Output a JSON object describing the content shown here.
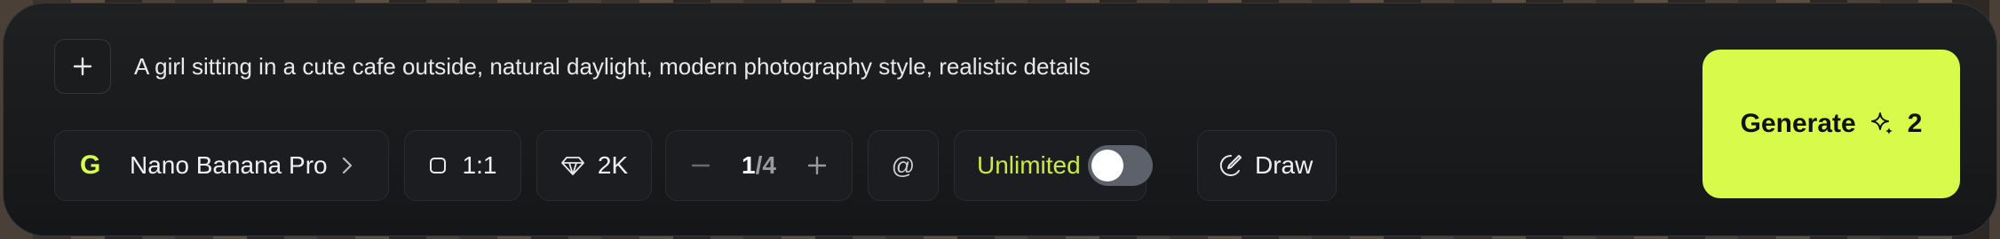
{
  "prompt": {
    "text": "A girl sitting in a cute cafe outside, natural daylight, modern photography style, realistic details"
  },
  "toolbar": {
    "add_icon": "plus-icon",
    "model": {
      "logo": "G",
      "label": "Nano Banana Pro",
      "icon": "chevron-right-icon"
    },
    "aspect_ratio": {
      "label": "1:1",
      "icon": "square-icon"
    },
    "resolution": {
      "label": "2K",
      "icon": "diamond-icon"
    },
    "count": {
      "current": "1",
      "total": "/4"
    },
    "mention": {
      "label": "@"
    },
    "unlimited": {
      "label": "Unlimited",
      "enabled": false
    },
    "draw": {
      "label": "Draw",
      "icon": "brush-icon"
    }
  },
  "generate": {
    "label": "Generate",
    "cost": "2",
    "icon": "sparkle-icon"
  },
  "colors": {
    "accent": "#d8fa4a",
    "bar_background": "#17181a",
    "toggle_off": "#5d616b"
  }
}
